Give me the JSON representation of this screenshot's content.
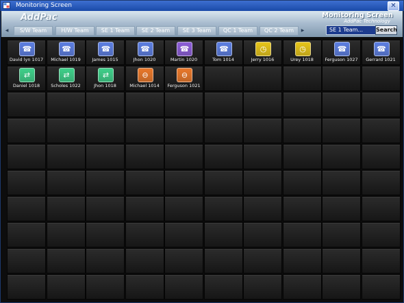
{
  "window": {
    "title": "Monitoring Screen",
    "close_label": "✕"
  },
  "header": {
    "brand": "AddPac",
    "screen_title": "Monitoring Screen",
    "screen_subtitle": "AddPac Technology"
  },
  "tabs": [
    "S/W Team",
    "H/W Team",
    "SE 1 Team",
    "SE 2 Team",
    "SE 3 Team",
    "QC 1 Team",
    "QC 2 Team"
  ],
  "search": {
    "value": "SE 1 Team...",
    "button_label": "Search"
  },
  "status_colors": {
    "blue": "#5d7fe2",
    "purple": "#8d5ed8",
    "yellow": "#e7c51a",
    "green": "#3fd08a",
    "orange": "#e9782a"
  },
  "users": [
    {
      "name": "David lyn 1017",
      "status": "blue",
      "icon": "user-phone-icon"
    },
    {
      "name": "Michael 1019",
      "status": "blue",
      "icon": "user-phone-icon"
    },
    {
      "name": "James 1015",
      "status": "blue",
      "icon": "user-phone-icon"
    },
    {
      "name": "Jhon 1020",
      "status": "blue",
      "icon": "user-phone-icon"
    },
    {
      "name": "Martin 1020",
      "status": "purple",
      "icon": "user-phone-icon"
    },
    {
      "name": "Tom 1014",
      "status": "blue",
      "icon": "user-phone-icon"
    },
    {
      "name": "Jerry 1016",
      "status": "yellow",
      "icon": "user-clock-icon"
    },
    {
      "name": "Urey 1018",
      "status": "yellow",
      "icon": "user-clock-icon"
    },
    {
      "name": "Ferguson 1027",
      "status": "blue",
      "icon": "user-phone-icon"
    },
    {
      "name": "Gerrard 1021",
      "status": "blue",
      "icon": "user-phone-icon"
    },
    {
      "name": "Daniel 1018",
      "status": "green",
      "icon": "user-connected-icon"
    },
    {
      "name": "Scholes 1022",
      "status": "green",
      "icon": "user-connected-icon"
    },
    {
      "name": "Jhon 1018",
      "status": "green",
      "icon": "user-connected-icon"
    },
    {
      "name": "Michael 1014",
      "status": "orange",
      "icon": "user-blocked-icon"
    },
    {
      "name": "Ferguson 1021",
      "status": "orange",
      "icon": "user-blocked-icon"
    }
  ]
}
